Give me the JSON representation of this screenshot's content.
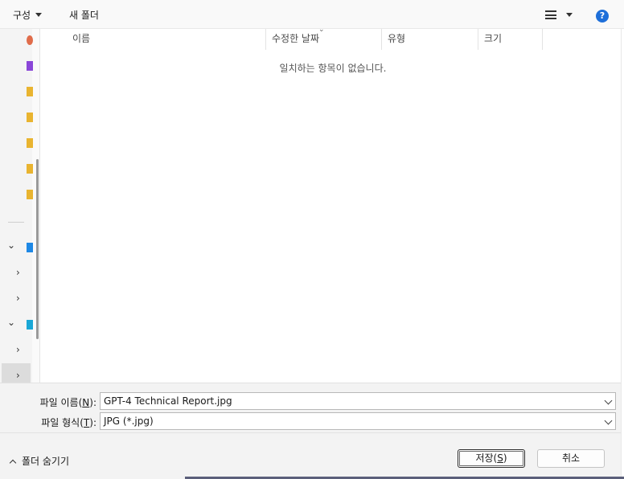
{
  "toolbar": {
    "organize_label": "구성",
    "new_folder_label": "새 폴더",
    "help_glyph": "?"
  },
  "nav": {
    "icons": [
      {
        "name": "recent-icon",
        "color": "#e06c4a"
      },
      {
        "name": "library-icon",
        "color": "#8a46d8"
      },
      {
        "name": "folder-icon-1",
        "color": "#e9b430"
      },
      {
        "name": "folder-icon-2",
        "color": "#e9b430"
      },
      {
        "name": "folder-icon-3",
        "color": "#e9b430"
      },
      {
        "name": "folder-icon-4",
        "color": "#e9b430"
      },
      {
        "name": "folder-icon-5",
        "color": "#e9b430"
      },
      {
        "name": "cloud-drive-icon",
        "color": "#1e88e5"
      },
      {
        "name": "network-drive-icon",
        "color": "#1aa7d6"
      }
    ],
    "chevrons": [
      "⌄",
      "›",
      "›",
      "⌄",
      "›",
      "›"
    ]
  },
  "filelist": {
    "columns": [
      "이름",
      "수정한 날짜",
      "유형",
      "크기"
    ],
    "sort_indicator": "⌄",
    "empty_message": "일치하는 항목이 없습니다."
  },
  "form": {
    "filename_label_prefix": "파일 이름(",
    "filename_label_key": "N",
    "filename_label_suffix": "):",
    "filename_value": "GPT-4 Technical Report.jpg",
    "filetype_label_prefix": "파일 형식(",
    "filetype_label_key": "T",
    "filetype_label_suffix": "):",
    "filetype_value": "JPG (*.jpg)"
  },
  "footer": {
    "hide_folders_label": "폴더 숨기기",
    "save_label_prefix": "저장(",
    "save_label_key": "S",
    "save_label_suffix": ")",
    "cancel_label": "취소"
  }
}
